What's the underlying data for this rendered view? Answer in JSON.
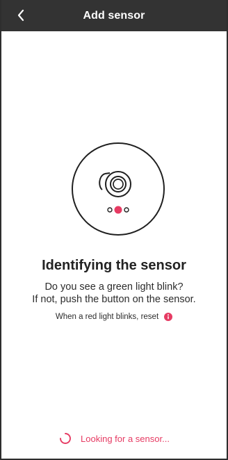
{
  "header": {
    "title": "Add sensor"
  },
  "icons": {
    "back": "chevron-left-icon",
    "sensor": "sensor-icon",
    "info": "info-icon",
    "spinner": "spinner-icon"
  },
  "main": {
    "title": "Identifying the sensor",
    "line1": "Do you see a green light blink?",
    "line2": "If not, push the button on the sensor.",
    "reset_text": "When a red light blinks, reset"
  },
  "status": {
    "text": "Looking for a sensor..."
  },
  "colors": {
    "header": "#333333",
    "accent": "#e63b63",
    "text": "#2c2c2c"
  }
}
